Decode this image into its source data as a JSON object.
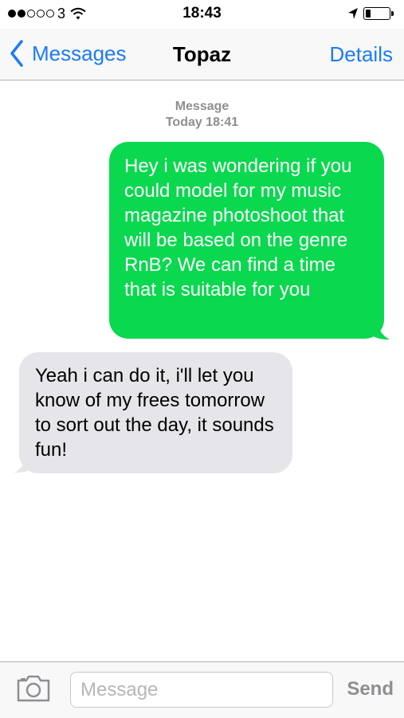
{
  "status_bar": {
    "carrier": "3",
    "time": "18:43",
    "signal_strength": "2 of 5",
    "icons": [
      "signal-dots-icon",
      "wifi-icon",
      "location-arrow-icon",
      "battery-icon"
    ]
  },
  "nav": {
    "back_label": "Messages",
    "title": "Topaz",
    "details_label": "Details"
  },
  "conversation": {
    "timestamp_header": "Message",
    "timestamp_detail": "Today 18:41",
    "messages": [
      {
        "direction": "outgoing",
        "text": "Hey i was wondering if you could model for my music magazine photoshoot that will be based on the genre RnB? We can find a time that is suitable for you"
      },
      {
        "direction": "incoming",
        "text": "Yeah i can do it, i'll let you know of my frees tomorrow to sort out the day, it sounds fun!"
      }
    ]
  },
  "input_bar": {
    "placeholder": "Message",
    "value": "",
    "send_label": "Send",
    "camera_icon": "camera-icon"
  },
  "colors": {
    "accent": "#1d7cf2",
    "outgoing_bubble": "#0ad84f",
    "incoming_bubble": "#e5e5ea",
    "secondary_text": "#8e8e93"
  }
}
